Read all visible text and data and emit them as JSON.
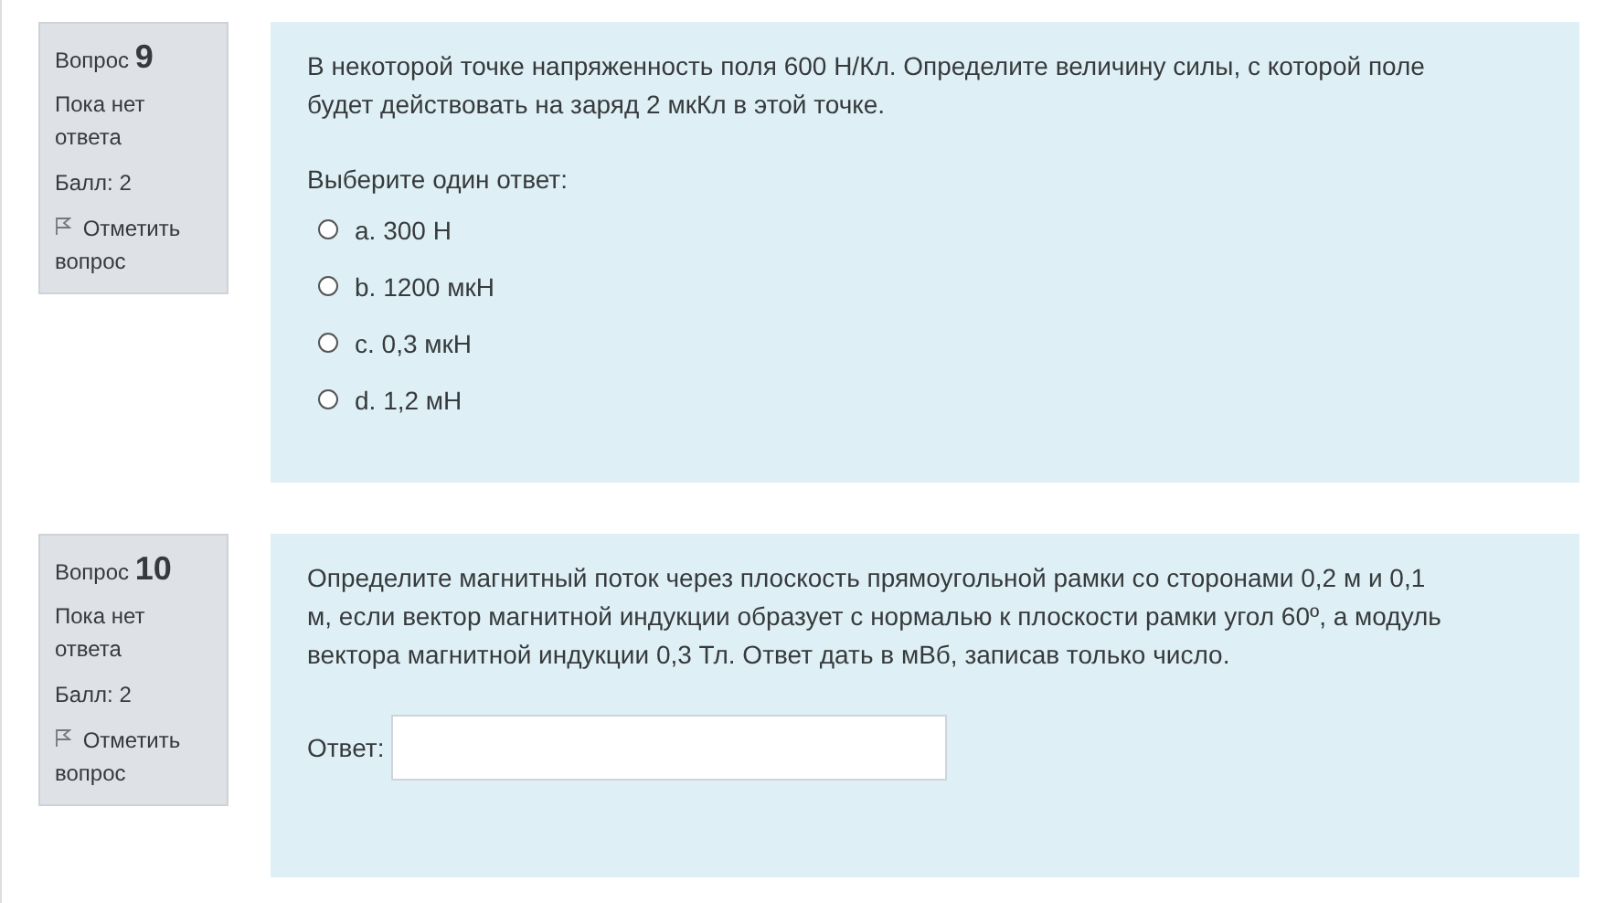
{
  "questions": [
    {
      "kind": "multichoice",
      "label": "Вопрос",
      "number": "9",
      "status": "Пока нет ответа",
      "grade": "Балл: 2",
      "flag": "Отметить вопрос",
      "text": "В некоторой точке напряженность поля 600 Н/Кл. Определите величину силы, с которой поле будет действовать на заряд 2 мкКл в этой точке.",
      "prompt": "Выберите один ответ:",
      "options": [
        {
          "letter": "a.",
          "text": "300 Н",
          "selected": false
        },
        {
          "letter": "b.",
          "text": "1200 мкН",
          "selected": false
        },
        {
          "letter": "c.",
          "text": "0,3 мкН",
          "selected": false
        },
        {
          "letter": "d.",
          "text": "1,2 мН",
          "selected": false
        }
      ]
    },
    {
      "kind": "shortanswer",
      "label": "Вопрос",
      "number": "10",
      "status": "Пока нет ответа",
      "grade": "Балл: 2",
      "flag": "Отметить вопрос",
      "text": "Определите магнитный поток через плоскость прямоугольной рамки со сторонами 0,2 м и 0,1 м, если вектор магнитной индукции образует с нормалью к плоскости рамки угол 60º, а модуль вектора магнитной индукции 0,3 Тл. Ответ дать в мВб, записав только число.",
      "answer_label": "Ответ:"
    }
  ]
}
